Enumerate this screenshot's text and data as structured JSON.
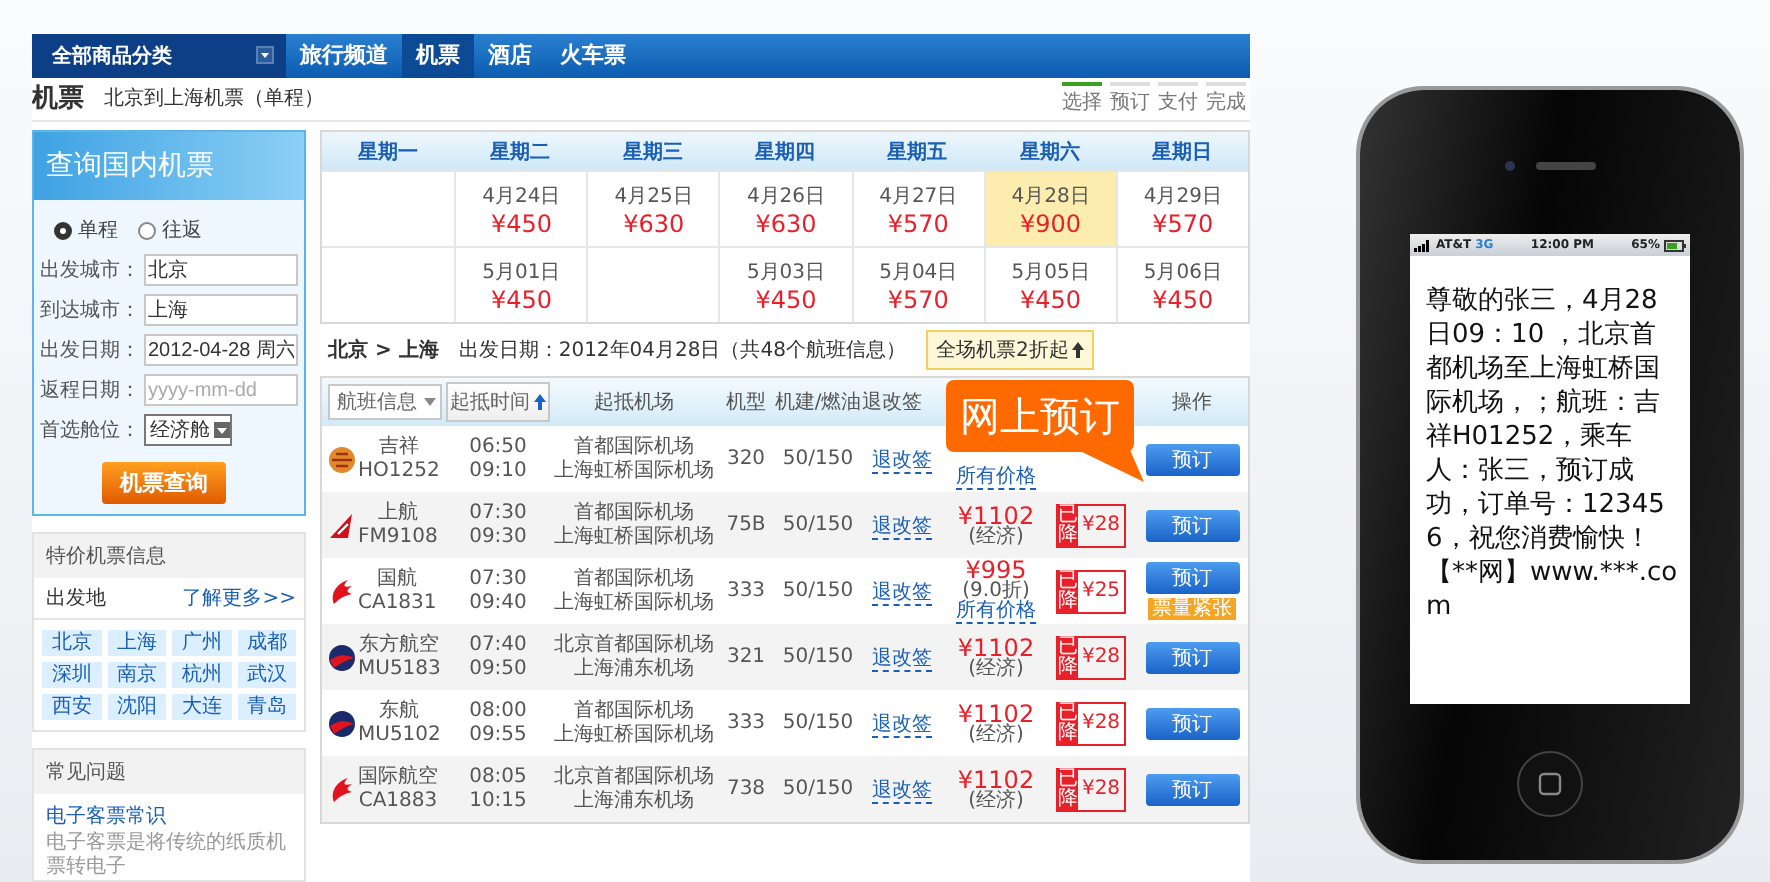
{
  "nav": {
    "category_menu": "全部商品分类",
    "tabs": [
      {
        "label": "旅行频道",
        "selected": false
      },
      {
        "label": "机票",
        "selected": true
      },
      {
        "label": "酒店",
        "selected": false
      },
      {
        "label": "火车票",
        "selected": false
      }
    ]
  },
  "page_title": "机票",
  "subtitle": "北京到上海机票（单程）",
  "steps": [
    {
      "label": "选择",
      "selected": true
    },
    {
      "label": "预订",
      "selected": false
    },
    {
      "label": "支付",
      "selected": false
    },
    {
      "label": "完成",
      "selected": false
    }
  ],
  "search_panel": {
    "title": "查询国内机票",
    "trip_types": [
      {
        "label": "单程",
        "selected": true
      },
      {
        "label": "往返",
        "selected": false
      }
    ],
    "fields": [
      {
        "kind": "input",
        "label": "出发城市：",
        "value": "北京"
      },
      {
        "kind": "input",
        "label": "到达城市：",
        "value": "上海"
      },
      {
        "kind": "input",
        "label": "出发日期：",
        "value": "2012-04-28 周六"
      },
      {
        "kind": "input",
        "label": "返程日期：",
        "placeholder": "yyyy-mm-dd"
      },
      {
        "kind": "select",
        "label": "首选舱位：",
        "value": "经济舱"
      }
    ],
    "submit": "机票查询"
  },
  "deals": {
    "title": "特价机票信息",
    "origin_label": "出发地",
    "more_link": "了解更多>>",
    "cities": [
      "北京",
      "上海",
      "广州",
      "成都",
      "深圳",
      "南京",
      "杭州",
      "武汉",
      "西安",
      "沈阳",
      "大连",
      "青岛"
    ]
  },
  "faq": {
    "title": "常见问题",
    "items": [
      {
        "title": "电子客票常识",
        "text": "电子客票是将传统的纸质机票转电子"
      }
    ]
  },
  "calendar": {
    "weekdays": [
      "星期一",
      "星期二",
      "星期三",
      "星期四",
      "星期五",
      "星期六",
      "星期日"
    ],
    "weeks": [
      [
        {
          "kind": "empty"
        },
        {
          "kind": "day",
          "date": "4月24日",
          "price": "¥450",
          "selected": false
        },
        {
          "kind": "day",
          "date": "4月25日",
          "price": "¥630",
          "selected": false
        },
        {
          "kind": "day",
          "date": "4月26日",
          "price": "¥630",
          "selected": false
        },
        {
          "kind": "day",
          "date": "4月27日",
          "price": "¥570",
          "selected": false
        },
        {
          "kind": "day",
          "date": "4月28日",
          "price": "¥900",
          "selected": true
        },
        {
          "kind": "day",
          "date": "4月29日",
          "price": "¥570",
          "selected": false
        }
      ],
      [
        {
          "kind": "empty"
        },
        {
          "kind": "day",
          "date": "5月01日",
          "price": "¥450",
          "selected": false
        },
        {
          "kind": "empty"
        },
        {
          "kind": "day",
          "date": "5月03日",
          "price": "¥450",
          "selected": false
        },
        {
          "kind": "day",
          "date": "5月04日",
          "price": "¥570",
          "selected": false
        },
        {
          "kind": "day",
          "date": "5月05日",
          "price": "¥450",
          "selected": false
        },
        {
          "kind": "day",
          "date": "5月06日",
          "price": "¥450",
          "selected": false
        }
      ]
    ]
  },
  "route": {
    "path": "北京 > 上海",
    "summary": "出发日期：2012年04月28日（共48个航班信息）",
    "promo": "全场机票2折起"
  },
  "table": {
    "columns": [
      {
        "kind": "dropdown",
        "label": "航班信息"
      },
      {
        "kind": "sort",
        "label": "起抵时间"
      },
      {
        "kind": "text",
        "label": "起抵机场"
      },
      {
        "kind": "text",
        "label": "机型"
      },
      {
        "kind": "text",
        "label": "机建/燃油"
      },
      {
        "kind": "text",
        "label": "退改签"
      },
      {
        "kind": "text",
        "label": "操作"
      }
    ],
    "callout": "网上预订",
    "rows": [
      {
        "kind": "ball",
        "airline": "吉祥",
        "flight": "HO1252",
        "dep": "06:50",
        "arr": "09:10",
        "from": "首都国际机场",
        "to": "上海虹桥国际机场",
        "model": "320",
        "tax": "50/150",
        "rules": "退改签",
        "all_prices": "所有价格",
        "book": "预订"
      },
      {
        "kind": "tail",
        "airline": "上航",
        "flight": "FM9108",
        "dep": "07:30",
        "arr": "09:30",
        "from": "首都国际机场",
        "to": "上海虹桥国际机场",
        "model": "75B",
        "tax": "50/150",
        "rules": "退改签",
        "price": "¥1102",
        "fare": "(经济)",
        "discount": {
          "tag": "已降",
          "amount": "¥28"
        },
        "book": "预订"
      },
      {
        "kind": "bird",
        "airline": "国航",
        "flight": "CA1831",
        "dep": "07:30",
        "arr": "09:40",
        "from": "首都国际机场",
        "to": "上海虹桥国际机场",
        "model": "333",
        "tax": "50/150",
        "rules": "退改签",
        "price": "¥995",
        "fare": "(9.0折)",
        "all_prices": "所有价格",
        "discount": {
          "tag": "已降",
          "amount": "¥25"
        },
        "book": "预订",
        "stock": "票量紧张"
      },
      {
        "kind": "globe",
        "airline": "东方航空",
        "flight": "MU5183",
        "dep": "07:40",
        "arr": "09:50",
        "from": "北京首都国际机场",
        "to": "上海浦东机场",
        "model": "321",
        "tax": "50/150",
        "rules": "退改签",
        "price": "¥1102",
        "fare": "(经济)",
        "discount": {
          "tag": "已降",
          "amount": "¥28"
        },
        "book": "预订"
      },
      {
        "kind": "globe",
        "airline": "东航",
        "flight": "MU5102",
        "dep": "08:00",
        "arr": "09:55",
        "from": "首都国际机场",
        "to": "上海虹桥国际机场",
        "model": "333",
        "tax": "50/150",
        "rules": "退改签",
        "price": "¥1102",
        "fare": "(经济)",
        "discount": {
          "tag": "已降",
          "amount": "¥28"
        },
        "book": "预订"
      },
      {
        "kind": "bird",
        "airline": "国际航空",
        "flight": "CA1883",
        "dep": "08:05",
        "arr": "10:15",
        "from": "北京首都国际机场",
        "to": "上海浦东机场",
        "model": "738",
        "tax": "50/150",
        "rules": "退改签",
        "price": "¥1102",
        "fare": "(经济)",
        "discount": {
          "tag": "已降",
          "amount": "¥28"
        },
        "book": "预订"
      }
    ]
  },
  "phone": {
    "carrier": "AT&T",
    "network": "3G",
    "time": "12:00 PM",
    "battery": "65%",
    "message": "尊敬的张三，4月28日09：10 ，北京首都机场至上海虹桥国际机场，；航班：吉祥H01252，乘车人：张三，预订成功，订单号：123456，祝您消费愉快！【**网】www.***.com"
  }
}
